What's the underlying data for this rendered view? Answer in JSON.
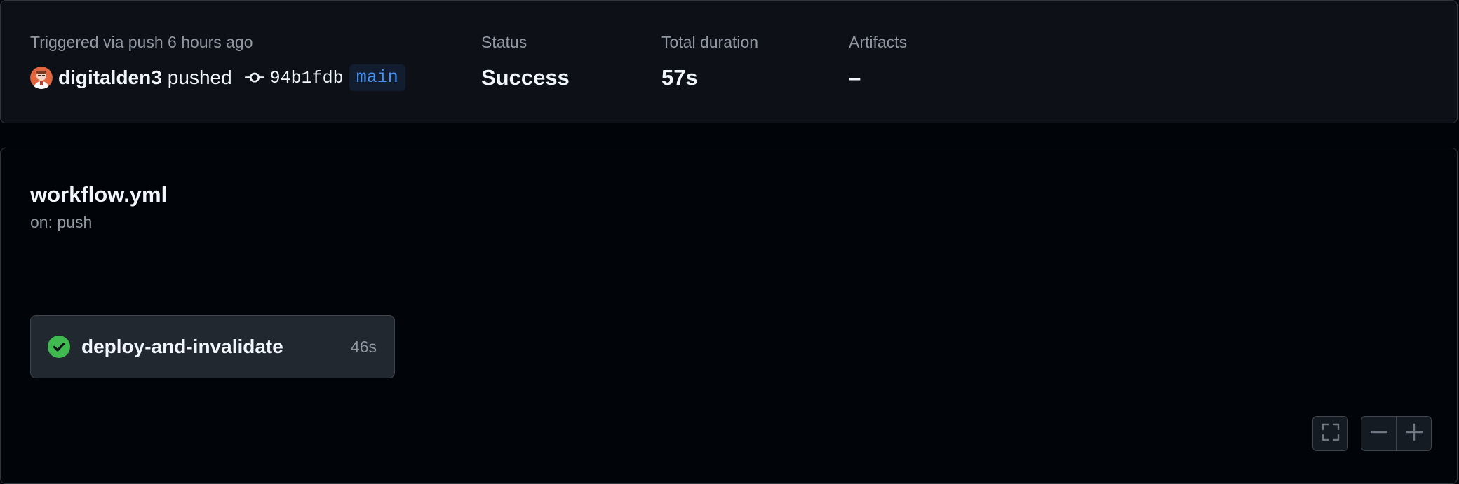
{
  "summary": {
    "trigger_label": "Triggered via push 6 hours ago",
    "actor": "digitalden3",
    "action": "pushed",
    "commit_sha": "94b1fdb",
    "branch": "main",
    "status_label": "Status",
    "status_value": "Success",
    "duration_label": "Total duration",
    "duration_value": "57s",
    "artifacts_label": "Artifacts",
    "artifacts_value": "–"
  },
  "workflow": {
    "file": "workflow.yml",
    "trigger": "on: push",
    "jobs": [
      {
        "name": "deploy-and-invalidate",
        "duration": "46s",
        "status": "success",
        "status_icon": "check-circle-fill-icon"
      }
    ]
  },
  "controls": {
    "fullscreen_icon": "screen-full-icon",
    "zoom_out_icon": "dash-icon",
    "zoom_in_icon": "plus-icon"
  },
  "colors": {
    "page_bg": "#010409",
    "panel_bg": "#0d1117",
    "border": "#30363d",
    "text_primary": "#f0f6fc",
    "text_muted": "#9198a1",
    "success": "#3fb950",
    "branch_text": "#4493f8",
    "branch_bg": "#121d2f",
    "job_card_bg": "#212830"
  }
}
